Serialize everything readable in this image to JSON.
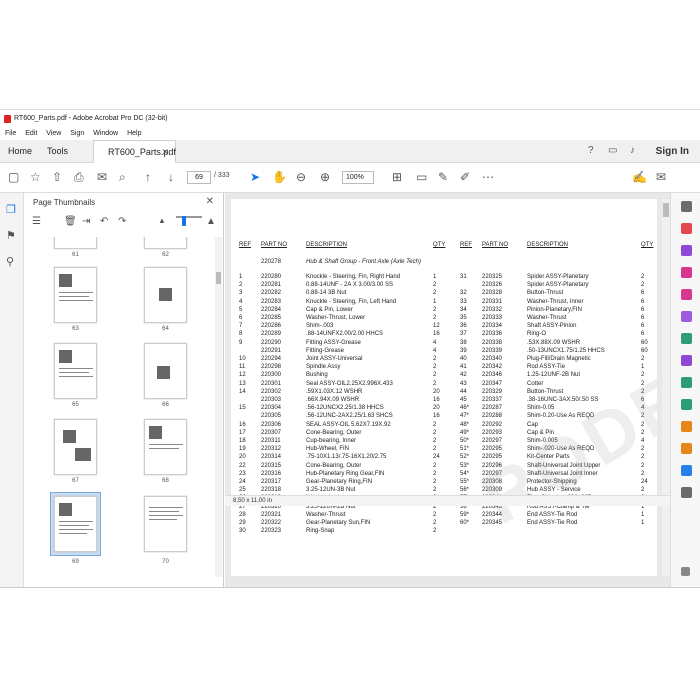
{
  "window": {
    "title": "RT600_Parts.pdf - Adobe Acrobat Pro DC (32-bit)"
  },
  "menu": [
    "File",
    "Edit",
    "View",
    "Sign",
    "Window",
    "Help"
  ],
  "tabs": {
    "home": "Home",
    "tools": "Tools",
    "doc": "RT600_Parts.pdf",
    "sign_in": "Sign In"
  },
  "toolbar": {
    "page_current": "69",
    "page_total": "/ 333",
    "zoom": "100%"
  },
  "panel": {
    "title": "Page Thumbnails"
  },
  "thumbnails": [
    "61",
    "62",
    "63",
    "64",
    "65",
    "66",
    "67",
    "68",
    "69",
    "70"
  ],
  "status": {
    "size": "8,50 x 11,00 in"
  },
  "watermark": "RODERO",
  "table": {
    "headers": {
      "ref": "REF",
      "part": "PART NO",
      "desc": "DESCRIPTION",
      "qty": "QTY"
    },
    "group_part": "220278",
    "group_desc": "Hub & Shaft Group - Front Axle (Axle Tech)",
    "left": [
      [
        "1",
        "220280",
        "Knuckle - Steering, Fin, Right Hand",
        "1"
      ],
      [
        "2",
        "220281",
        "0.88-14UNF - 2A X 3.00/3.00 SS",
        "2"
      ],
      [
        "3",
        "220282",
        "0.88-14 3B Nut",
        "2"
      ],
      [
        "4",
        "220283",
        "Knuckle - Steering, Fin, Left Hand",
        "1"
      ],
      [
        "5",
        "220284",
        "Cap & Pin, Lower",
        "2"
      ],
      [
        "6",
        "220285",
        "Washer-Thrust, Lower",
        "2"
      ],
      [
        "7",
        "220286",
        "Shim-.003",
        "12"
      ],
      [
        "8",
        "220289",
        ".88-14UNFX2.00/2.00 HHCS",
        "16"
      ],
      [
        "9",
        "220290",
        "Fitting ASSY-Grease",
        "4"
      ],
      [
        "",
        "220291",
        "Fitting-Grease",
        "4"
      ],
      [
        "10",
        "220294",
        "Joint ASSY-Universal",
        "2"
      ],
      [
        "11",
        "220298",
        "Spindle Assy",
        "2"
      ],
      [
        "12",
        "220300",
        "Bushing",
        "2"
      ],
      [
        "13",
        "220301",
        "Seal ASSY-OIL2.25X2.996X.433",
        "2"
      ],
      [
        "14",
        "220302",
        ".59X1.03X.12 WSHR",
        "20"
      ],
      [
        "",
        "220303",
        ".66X.94X.09 WSHR",
        "16"
      ],
      [
        "15",
        "220304",
        ".56-12UNCX2.25/1.38 HHCS",
        "20"
      ],
      [
        "",
        "220305",
        ".56-12UNC-2AX2.25/1.63 SHCS",
        "16"
      ],
      [
        "16",
        "220306",
        "SEAL ASSY-OIL 5.62X7.19X.92",
        "2"
      ],
      [
        "17",
        "220307",
        "Cone-Bearing, Outer",
        "2"
      ],
      [
        "18",
        "220311",
        "Cup-bearing, Inner",
        "2"
      ],
      [
        "19",
        "220312",
        "Hub-Wheel, FIN",
        "2"
      ],
      [
        "20",
        "220314",
        ".75-10X1.13/.75-16X1.20/2.75",
        "24"
      ],
      [
        "22",
        "220315",
        "Cone-Bearing, Outer",
        "2"
      ],
      [
        "23",
        "220316",
        "Hub-Planetary Ring Gear,FIN",
        "2"
      ],
      [
        "24",
        "220317",
        "Gear-Planetary Ring,FIN",
        "2"
      ],
      [
        "25",
        "220318",
        "3.25-12UN-3B Nut",
        "2"
      ],
      [
        "26",
        "220319",
        "Washer-Lock",
        "2"
      ],
      [
        "27",
        "220320",
        "3.25-12UN-2B Nut",
        "2"
      ],
      [
        "28",
        "220321",
        "Washer-Thrust",
        "2"
      ],
      [
        "29",
        "220322",
        "Gear-Planetary Sun,FIN",
        "2"
      ],
      [
        "30",
        "220323",
        "Ring-Snap",
        "2"
      ]
    ],
    "right": [
      [
        "31",
        "220325",
        "Spider ASSY-Planetary",
        "2"
      ],
      [
        "",
        "220326",
        "Spider ASSY-Planetary",
        "2"
      ],
      [
        "32",
        "220328",
        "Button-Thrust",
        "6"
      ],
      [
        "33",
        "220331",
        "Washer-Thrust, Inner",
        "6"
      ],
      [
        "34",
        "220332",
        "Pinion-Planetary,FIN",
        "6"
      ],
      [
        "35",
        "220333",
        "Washer-Thrust",
        "6"
      ],
      [
        "36",
        "220334",
        "Shaft ASSY-Pinion",
        "6"
      ],
      [
        "37",
        "220336",
        "Ring-O",
        "6"
      ],
      [
        "38",
        "220338",
        ".53X.88X.09 WSHR",
        "60"
      ],
      [
        "39",
        "220339",
        ".50-13UNCX1.75/1.25 HHCS",
        "60"
      ],
      [
        "40",
        "220340",
        "Plug-Fill/Drain Magnetic",
        "2"
      ],
      [
        "41",
        "220342",
        "Rod ASSY-Tie",
        "1"
      ],
      [
        "42",
        "220346",
        "1.25-12UNF-2B Nut",
        "2"
      ],
      [
        "43",
        "220347",
        "Cotter",
        "2"
      ],
      [
        "44",
        "220329",
        "Button-Thrust",
        "2"
      ],
      [
        "45",
        "220337",
        ".38-16UNC-3AX.50/.50 SS",
        "6"
      ],
      [
        "46*",
        "220287",
        "Shim-0.05",
        "4"
      ],
      [
        "47*",
        "220288",
        "Shim-0.20-Use As REQD",
        "2"
      ],
      [
        "48*",
        "220292",
        "Cap",
        "2"
      ],
      [
        "49*",
        "220293",
        "Cap & Pin",
        "2"
      ],
      [
        "50*",
        "220297",
        "Shim-0.005",
        "4"
      ],
      [
        "51*",
        "220295",
        "Shim-.020-Use As REQD",
        "2"
      ],
      [
        "52*",
        "220295",
        "Kit-Center Parts",
        "2"
      ],
      [
        "53*",
        "220296",
        "Shaft-Universal Joint Upper",
        "2"
      ],
      [
        "54*",
        "220297",
        "Shaft-Universal Joint Inner",
        "2"
      ],
      [
        "55*",
        "220308",
        "Protector-Shipping",
        "24"
      ],
      [
        "56*",
        "220309",
        "Hub ASSY - Service",
        "2"
      ],
      [
        "57*",
        "220341",
        "Plug-Shipping .396/.267",
        "2"
      ],
      [
        "58*",
        "220343",
        "Rod ASSY-Clamp & Tie",
        "1"
      ],
      [
        "59*",
        "220344",
        "End ASSY-Tie Rod",
        "1"
      ],
      [
        "60*",
        "220345",
        "End ASSY-Tie Rod",
        "1"
      ]
    ]
  }
}
